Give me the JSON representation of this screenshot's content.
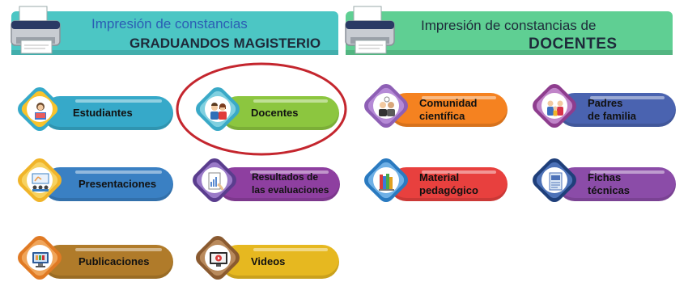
{
  "banners": {
    "graduandos": {
      "line1": "Impresión de constancias",
      "line2": "GRADUANDOS MAGISTERIO",
      "color": "#4cc6c4"
    },
    "docentes": {
      "line1": "Impresión de constancias de",
      "line2": "DOCENTES",
      "color": "#5fcf93"
    }
  },
  "buttons": [
    {
      "id": "estudiantes",
      "label": "Estudiantes",
      "color": "#36a9c9",
      "icon": "student-reading-icon"
    },
    {
      "id": "docentes",
      "label": "Docentes",
      "color": "#8cc63f",
      "icon": "teachers-icon"
    },
    {
      "id": "comunidad",
      "label_line1": "Comunidad",
      "label_line2": "científica",
      "color": "#f58220",
      "icon": "scientists-icon"
    },
    {
      "id": "padres",
      "label_line1": "Padres",
      "label_line2": "de familia",
      "color": "#4a63b0",
      "icon": "family-icon"
    },
    {
      "id": "presentaciones",
      "label": "Presentaciones",
      "color": "#3a80c3",
      "icon": "presentation-icon"
    },
    {
      "id": "resultados",
      "label_line1": "Resultados de",
      "label_line2": "las evaluaciones",
      "color": "#8e3fa0",
      "icon": "evaluation-results-icon"
    },
    {
      "id": "material",
      "label_line1": "Material",
      "label_line2": "pedagógico",
      "color": "#e8403e",
      "icon": "books-icon"
    },
    {
      "id": "fichas",
      "label_line1": "Fichas",
      "label_line2": "técnicas",
      "color": "#8b4ca8",
      "icon": "technical-sheet-icon"
    },
    {
      "id": "publicaciones",
      "label": "Publicaciones",
      "color": "#b07b2a",
      "icon": "publications-icon"
    },
    {
      "id": "videos",
      "label": "Videos",
      "color": "#e6b820",
      "icon": "video-player-icon"
    }
  ],
  "highlight_color": "#c4262e"
}
